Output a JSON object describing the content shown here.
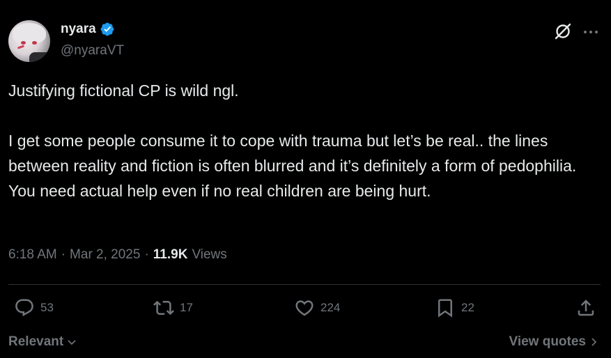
{
  "author": {
    "display_name": "nyara",
    "handle": "@nyaraVT",
    "verified": true
  },
  "tweet": {
    "paragraphs": [
      "Justifying fictional CP is wild ngl.",
      "I get some people consume it to cope with trauma but let’s be real.. the lines between reality and fiction is often blurred and it’s definitely a form of pedophilia. You need actual help even if no real children are being hurt."
    ]
  },
  "meta": {
    "time": "6:18 AM",
    "separator": "·",
    "date": "Mar 2, 2025",
    "views_count": "11.9K",
    "views_label": "Views"
  },
  "actions": {
    "replies": "53",
    "reposts": "17",
    "likes": "224",
    "bookmarks": "22"
  },
  "footer": {
    "sort_label": "Relevant",
    "quotes_label": "View quotes"
  },
  "colors": {
    "background": "#000000",
    "text": "#e7e9ea",
    "muted": "#71767b",
    "verified": "#1d9bf0",
    "divider": "#2f3336"
  }
}
